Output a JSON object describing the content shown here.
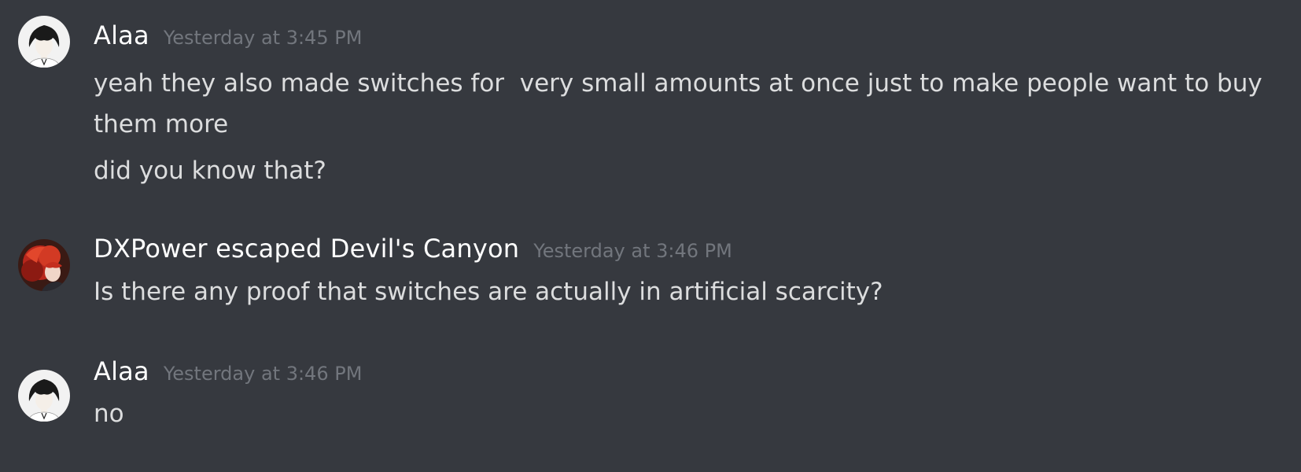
{
  "messages": [
    {
      "author": "Alaa",
      "timestamp": "Yesterday at 3:45 PM",
      "avatar_icon": "anime-boy-avatar-icon",
      "lines": [
        "yeah they also made switches for  very small amounts at once just to make people want to buy them more",
        "did you know that?"
      ]
    },
    {
      "author": "DXPower escaped Devil's Canyon",
      "timestamp": "Yesterday at 3:46 PM",
      "avatar_icon": "red-hair-avatar-icon",
      "lines": [
        "Is there any proof that switches are actually in artificial scarcity?"
      ]
    },
    {
      "author": "Alaa",
      "timestamp": "Yesterday at 3:46 PM",
      "avatar_icon": "anime-boy-avatar-icon",
      "lines": [
        "no"
      ]
    }
  ],
  "colors": {
    "background": "#36393f",
    "username": "#ffffff",
    "timestamp": "#72767d",
    "message_text": "#dcddde"
  }
}
